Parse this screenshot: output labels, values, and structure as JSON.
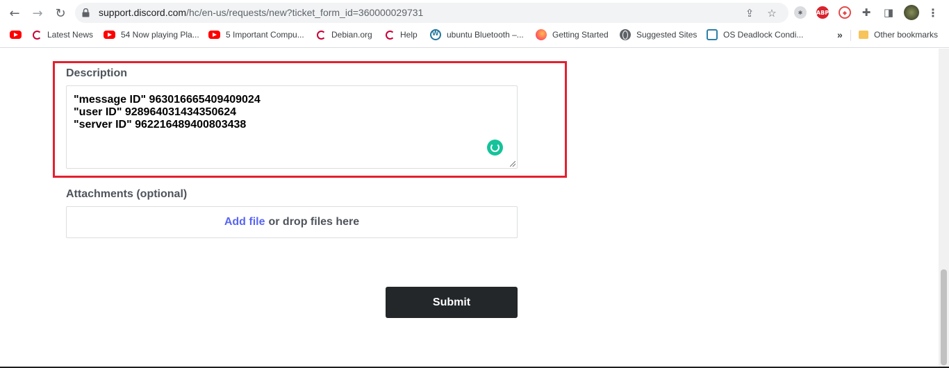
{
  "browser": {
    "url_host": "support.discord.com",
    "url_path": "/hc/en-us/requests/new?ticket_form_id=360000029731",
    "extensions": [
      "ABP"
    ],
    "bookmarks": [
      {
        "label": "",
        "icon": "youtube-icon"
      },
      {
        "label": "Latest News",
        "icon": "debian-icon"
      },
      {
        "label": "54 Now playing Pla...",
        "icon": "youtube-icon"
      },
      {
        "label": "5 Important Compu...",
        "icon": "youtube-icon"
      },
      {
        "label": "Debian.org",
        "icon": "debian-icon"
      },
      {
        "label": "Help",
        "icon": "debian-icon"
      },
      {
        "label": "ubuntu Bluetooth –...",
        "icon": "wordpress-icon"
      },
      {
        "label": "Getting Started",
        "icon": "firefox-icon"
      },
      {
        "label": "Suggested Sites",
        "icon": "globe-icon"
      },
      {
        "label": "OS Deadlock Condi...",
        "icon": "page-icon"
      }
    ],
    "overflow": "»",
    "other_bookmarks": "Other bookmarks"
  },
  "form": {
    "description_label": "Description",
    "description_lines": [
      "\"message ID\" 963016665409409024",
      "\"user ID\" 928964031434350624",
      "\"server ID\" 962216489400803438"
    ],
    "attachments_label": "Attachments (optional)",
    "add_file": "Add file",
    "drop_text": "or drop files here",
    "submit_label": "Submit"
  },
  "colors": {
    "highlight": "#e3202f",
    "link": "#5865f2",
    "submit_bg": "#23272a",
    "grammarly": "#15c39a"
  }
}
